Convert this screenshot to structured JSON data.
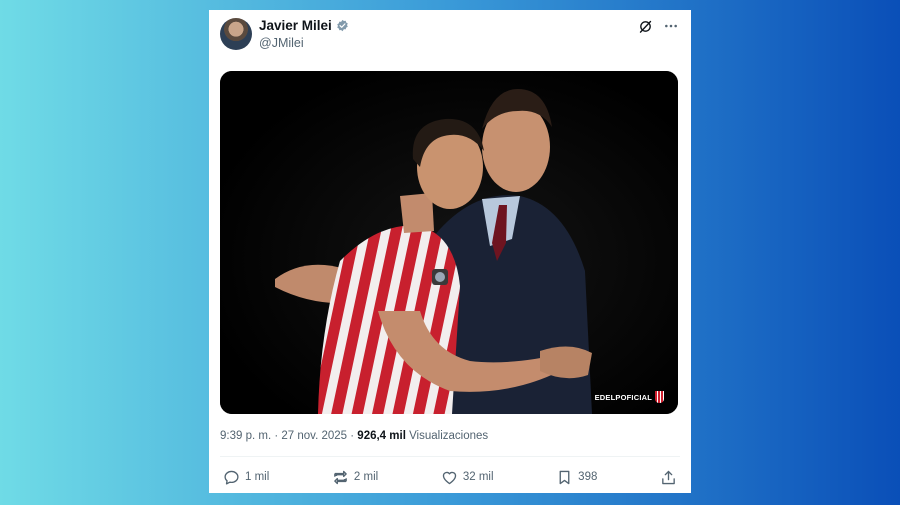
{
  "tweet": {
    "author_name": "Javier Milei",
    "author_handle": "@JMilei",
    "image_watermark": "EDELPOFICIAL",
    "time": "9:39 p. m.",
    "separator": "·",
    "date": "27 nov. 2025",
    "views_count": "926,4 mil",
    "views_label": "Visualizaciones"
  },
  "actions": {
    "replies": "1 mil",
    "reposts": "2 mil",
    "likes": "32 mil",
    "bookmarks": "398"
  },
  "icons": {
    "verified": "verified-badge-icon",
    "grok": "grok-icon",
    "more": "more-icon",
    "reply": "reply-icon",
    "repost": "repost-icon",
    "like": "heart-icon",
    "bookmark": "bookmark-icon",
    "share": "share-icon"
  },
  "colors": {
    "verified": "#829aab",
    "text_primary": "#0f1419",
    "text_secondary": "#536471",
    "club_red": "#d1202f"
  }
}
